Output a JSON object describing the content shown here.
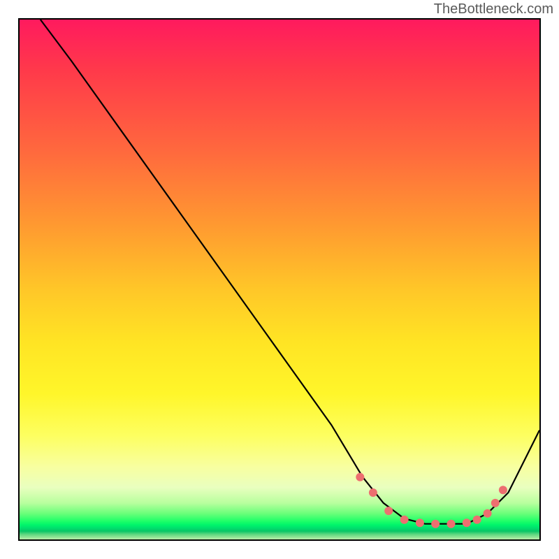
{
  "watermark": "TheBottleneck.com",
  "chart_data": {
    "type": "line",
    "title": "",
    "xlabel": "",
    "ylabel": "",
    "xlim": [
      0,
      100
    ],
    "ylim": [
      0,
      100
    ],
    "series": [
      {
        "name": "curve",
        "x": [
          4,
          10,
          20,
          30,
          40,
          50,
          60,
          66,
          70,
          74,
          78,
          82,
          86,
          90,
          94,
          100
        ],
        "y": [
          100,
          92,
          78,
          64,
          50,
          36,
          22,
          12,
          7,
          4,
          3,
          3,
          3,
          5,
          9,
          21
        ]
      }
    ],
    "markers": {
      "name": "dots",
      "color": "#ed6f70",
      "x": [
        65.5,
        68,
        71,
        74,
        77,
        80,
        83,
        86,
        88,
        90,
        91.5,
        93
      ],
      "y": [
        12,
        9,
        5.5,
        3.8,
        3.2,
        3,
        3,
        3.2,
        3.8,
        5,
        7,
        9.5
      ]
    }
  }
}
